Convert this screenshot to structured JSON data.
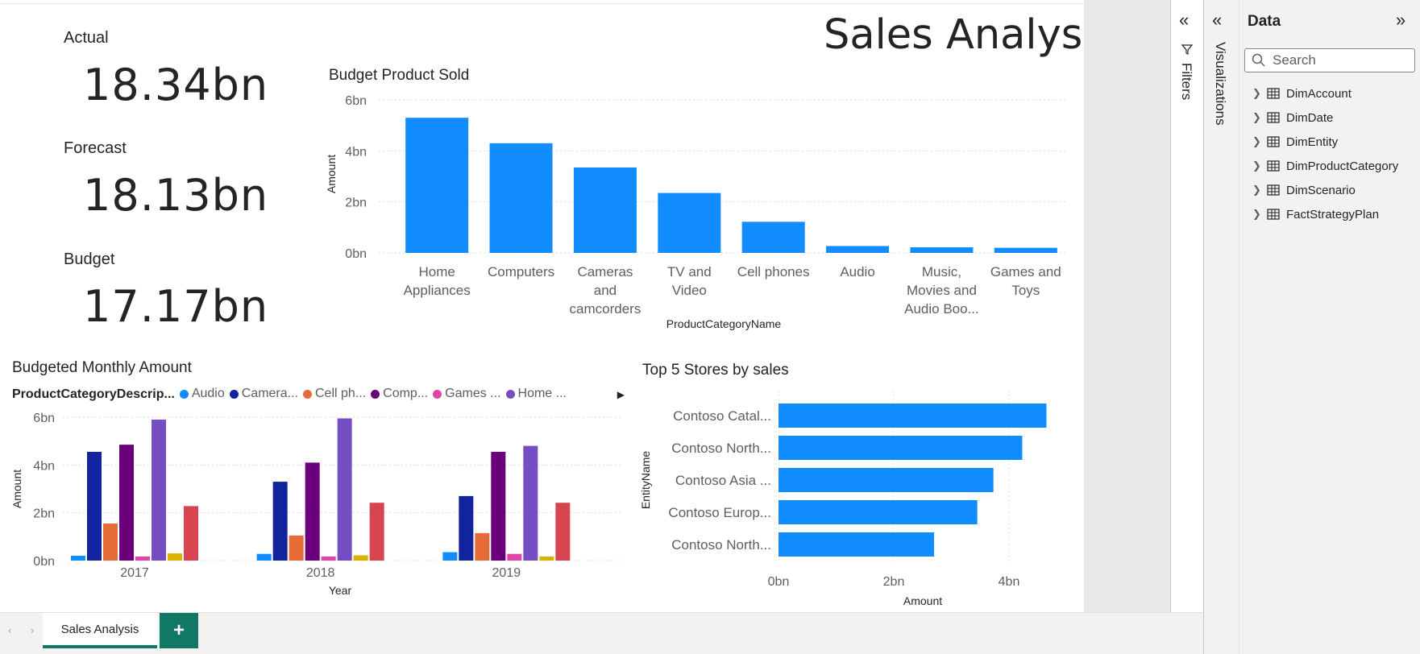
{
  "page": {
    "title": "Sales Analysis"
  },
  "kpis": [
    {
      "label": "Actual",
      "value": "18.34bn"
    },
    {
      "label": "Forecast",
      "value": "18.13bn"
    },
    {
      "label": "Budget",
      "value": "17.17bn"
    }
  ],
  "colors": {
    "accent": "#118dff",
    "audio": "#118dff",
    "cameras": "#12239e",
    "cell_phones": "#e66c37",
    "computers": "#6b007b",
    "games": "#e044a7",
    "home": "#744ec2",
    "music": "#d9b300",
    "tv": "#d64550",
    "tab_green": "#117865"
  },
  "chart_data": [
    {
      "type": "bar",
      "title": "Budget Product Sold",
      "xlabel": "ProductCategoryName",
      "ylabel": "Amount",
      "ylim": [
        0,
        6
      ],
      "y_unit": "bn",
      "yticks": [
        "0bn",
        "2bn",
        "4bn",
        "6bn"
      ],
      "categories": [
        [
          "Home",
          "Appliances"
        ],
        [
          "Computers"
        ],
        [
          "Cameras",
          "and",
          "camcorders"
        ],
        [
          "TV and",
          "Video"
        ],
        [
          "Cell phones"
        ],
        [
          "Audio"
        ],
        [
          "Music,",
          "Movies and",
          "Audio Boo..."
        ],
        [
          "Games and",
          "Toys"
        ]
      ],
      "values": [
        5.3,
        4.3,
        3.35,
        2.35,
        1.22,
        0.27,
        0.22,
        0.2
      ],
      "grid": true
    },
    {
      "type": "bar",
      "title": "Budgeted Monthly Amount",
      "xlabel": "Year",
      "ylabel": "Amount",
      "ylim": [
        0,
        6
      ],
      "y_unit": "bn",
      "yticks": [
        "0bn",
        "2bn",
        "4bn",
        "6bn"
      ],
      "legend_title": "ProductCategoryDescrip...",
      "legend": [
        {
          "label": "Audio",
          "color_key": "audio"
        },
        {
          "label": "Camera...",
          "color_key": "cameras"
        },
        {
          "label": "Cell ph...",
          "color_key": "cell_phones"
        },
        {
          "label": "Comp...",
          "color_key": "computers"
        },
        {
          "label": "Games ...",
          "color_key": "games"
        },
        {
          "label": "Home ...",
          "color_key": "home"
        }
      ],
      "legend_placement": "top",
      "categories": [
        "2017",
        "2018",
        "2019"
      ],
      "series": [
        {
          "color_key": "audio",
          "values": [
            0.2,
            0.28,
            0.35
          ]
        },
        {
          "color_key": "cameras",
          "values": [
            4.55,
            3.3,
            2.7
          ]
        },
        {
          "color_key": "cell_phones",
          "values": [
            1.55,
            1.05,
            1.15
          ]
        },
        {
          "color_key": "computers",
          "values": [
            4.85,
            4.1,
            4.55
          ]
        },
        {
          "color_key": "games",
          "values": [
            0.17,
            0.17,
            0.28
          ]
        },
        {
          "color_key": "home",
          "values": [
            5.9,
            5.95,
            4.8
          ]
        },
        {
          "color_key": "music",
          "values": [
            0.3,
            0.22,
            0.17
          ]
        },
        {
          "color_key": "tv",
          "values": [
            2.28,
            2.42,
            2.42
          ]
        }
      ],
      "grid": true
    },
    {
      "type": "bar",
      "orientation": "horizontal",
      "title": "Top 5 Stores by sales",
      "xlabel": "Amount",
      "ylabel": "EntityName",
      "xlim": [
        0,
        5
      ],
      "x_unit": "bn",
      "xticks": [
        "0bn",
        "2bn",
        "4bn"
      ],
      "categories": [
        "Contoso Catal...",
        "Contoso North...",
        "Contoso Asia ...",
        "Contoso Europ...",
        "Contoso North..."
      ],
      "values": [
        4.65,
        4.23,
        3.73,
        3.45,
        2.7
      ],
      "grid": true
    }
  ],
  "tabs": {
    "active": "Sales Analysis",
    "add": "+",
    "prev": "‹",
    "next": "›"
  },
  "panes": {
    "filters": {
      "label": "Filters",
      "collapse": "«"
    },
    "visualizations": {
      "label": "Visualizations",
      "collapse": "«"
    },
    "data": {
      "title": "Data",
      "expand": "»",
      "search_placeholder": "Search",
      "tables": [
        "DimAccount",
        "DimDate",
        "DimEntity",
        "DimProductCategory",
        "DimScenario",
        "FactStrategyPlan"
      ]
    }
  }
}
